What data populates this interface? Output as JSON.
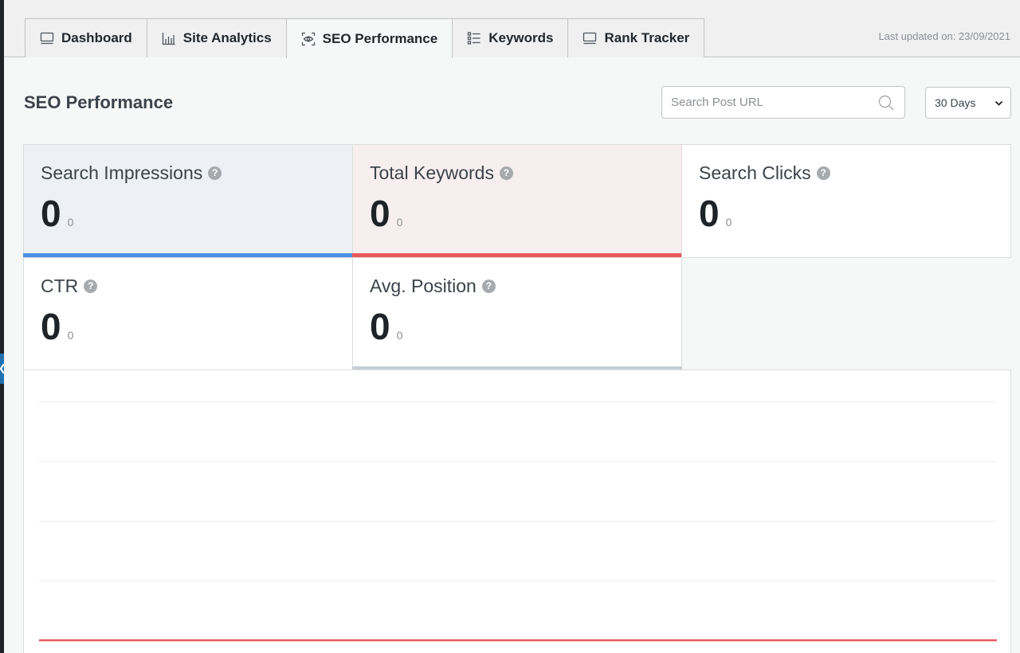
{
  "tabs": [
    {
      "label": "Dashboard",
      "icon": "monitor-icon",
      "active": false
    },
    {
      "label": "Site Analytics",
      "icon": "bar-chart-icon",
      "active": false
    },
    {
      "label": "SEO Performance",
      "icon": "eye-scan-icon",
      "active": true
    },
    {
      "label": "Keywords",
      "icon": "list-icon",
      "active": false
    },
    {
      "label": "Rank Tracker",
      "icon": "monitor-icon",
      "active": false
    }
  ],
  "last_updated": "Last updated on: 23/09/2021",
  "page_title": "SEO Performance",
  "search": {
    "placeholder": "Search Post URL",
    "value": ""
  },
  "range_select": {
    "value": "30 Days"
  },
  "stats": [
    {
      "label": "Search Impressions",
      "value": "0",
      "delta": "0",
      "accent": "#4a90e2"
    },
    {
      "label": "Total Keywords",
      "value": "0",
      "delta": "0",
      "accent": "#e85a5a"
    },
    {
      "label": "Search Clicks",
      "value": "0",
      "delta": "0",
      "accent": null
    },
    {
      "label": "CTR",
      "value": "0",
      "delta": "0",
      "accent": null
    },
    {
      "label": "Avg. Position",
      "value": "0",
      "delta": "0",
      "accent": "#c8cdd3"
    }
  ],
  "colors": {
    "impressions": "#4a90e2",
    "keywords": "#e85a5a",
    "position": "#c8cdd3",
    "grid": "#ececec"
  },
  "chart_data": {
    "type": "line",
    "title": "",
    "series": [
      {
        "values": [
          0,
          0
        ]
      }
    ],
    "grid": true,
    "line_color": "#e85a5a"
  }
}
